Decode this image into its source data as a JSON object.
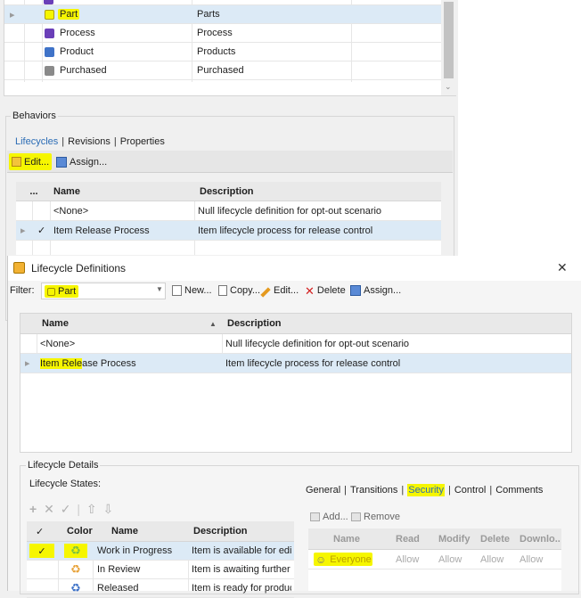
{
  "categories": {
    "rows": [
      {
        "name": "Part",
        "value": "Parts",
        "color": "#f6f600",
        "selected": true
      },
      {
        "name": "Process",
        "value": "Process",
        "color": "#6a3fb8"
      },
      {
        "name": "Product",
        "value": "Products",
        "color": "#3f73c8"
      },
      {
        "name": "Purchased",
        "value": "Purchased",
        "color": "#8a8a8a"
      }
    ]
  },
  "behaviors": {
    "title": "Behaviors",
    "tabs": [
      "Lifecycles",
      "Revisions",
      "Properties"
    ],
    "sep": "|",
    "edit_label": "Edit...",
    "assign_label": "Assign...",
    "col_dots": "...",
    "col_name": "Name",
    "col_desc": "Description",
    "rows": [
      {
        "check": "",
        "name": "<None>",
        "desc": "Null lifecycle definition for opt-out scenario"
      },
      {
        "check": "✓",
        "name": "Item Release Process",
        "desc": "Item lifecycle process for release control"
      }
    ]
  },
  "dialog": {
    "title": "Lifecycle Definitions",
    "close": "✕",
    "filter_label": "Filter:",
    "filter_value": "Part",
    "new_label": "New...",
    "copy_label": "Copy...",
    "edit_label": "Edit...",
    "delete_label": "Delete",
    "assign_label": "Assign...",
    "col_name": "Name",
    "col_desc": "Description",
    "rows": [
      {
        "name": "<None>",
        "desc": "Null lifecycle definition for opt-out scenario"
      },
      {
        "name_hl": "Item Rele",
        "name_rest": "ase Process",
        "desc": "Item lifecycle process for release control"
      }
    ]
  },
  "details": {
    "title": "Lifecycle Details",
    "states_label": "Lifecycle States:",
    "tabs": [
      "General",
      "Transitions",
      "Security",
      "Control",
      "Comments"
    ],
    "state_cols": [
      "Color",
      "Name",
      "Description"
    ],
    "states": [
      {
        "check": "✓",
        "name": "Work in Progress",
        "desc": "Item is available for edit...",
        "icon": "#7ac142"
      },
      {
        "check": "",
        "name": "In Review",
        "desc": "Item is awaiting further ...",
        "icon": "#e8a33a"
      },
      {
        "check": "",
        "name": "Released",
        "desc": "Item is ready for produc...",
        "icon": "#3f73c8"
      }
    ],
    "sec_add": "Add...",
    "sec_remove": "Remove",
    "sec_cols": [
      "Name",
      "Read",
      "Modify",
      "Delete",
      "Downlo..."
    ],
    "sec_rows": [
      {
        "name": "Everyone",
        "read": "Allow",
        "modify": "Allow",
        "delete": "Allow",
        "download": "Allow"
      }
    ]
  }
}
